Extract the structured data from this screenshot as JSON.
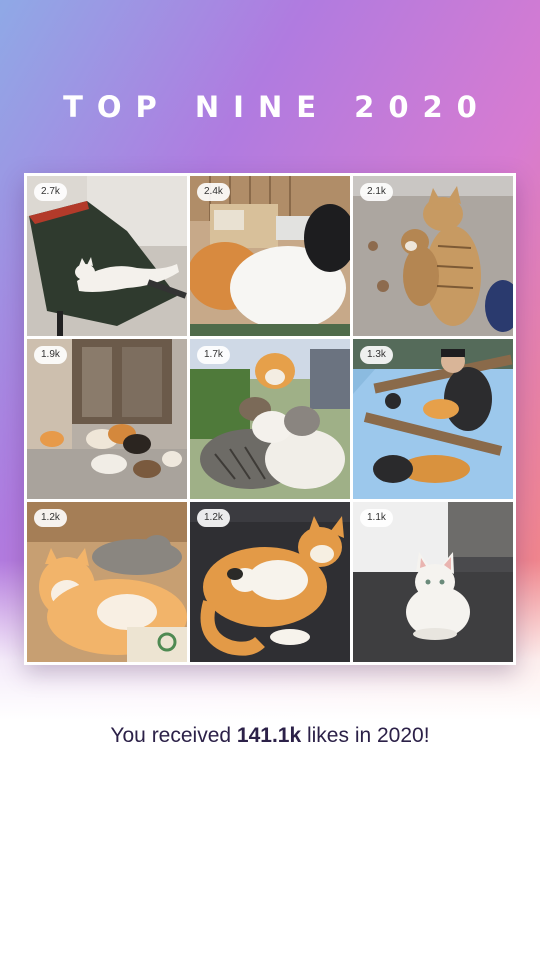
{
  "title": "TOP NINE 2020",
  "summary": {
    "prefix": "You received ",
    "likes": "141.1k",
    "suffix": " likes in 2020!"
  },
  "posts": [
    {
      "likes": "2.7k",
      "subject": "white cat lying in a wheelbarrow"
    },
    {
      "likes": "2.4k",
      "subject": "orange, white and black cats resting"
    },
    {
      "likes": "2.1k",
      "subject": "two tabby cats nuzzling"
    },
    {
      "likes": "1.9k",
      "subject": "group of cats in a doorway"
    },
    {
      "likes": "1.7k",
      "subject": "pile of cats sleeping together"
    },
    {
      "likes": "1.3k",
      "subject": "man petting cats on a boat"
    },
    {
      "likes": "1.2k",
      "subject": "orange and tabby cats cuddling"
    },
    {
      "likes": "1.2k",
      "subject": "orange cat with kitten"
    },
    {
      "likes": "1.1k",
      "subject": "white cat sitting on pavement"
    }
  ],
  "colors": {
    "gradient_start": "#8fa9e6",
    "gradient_mid": "#d77bd1",
    "gradient_end": "#f9a07d",
    "summary_text": "#2c2148"
  }
}
